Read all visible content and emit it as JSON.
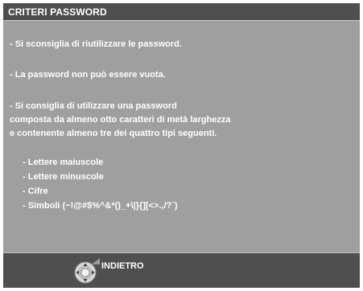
{
  "dialog": {
    "title": "CRITERI PASSWORD",
    "lines": [
      "- Si sconsiglia di riutilizzare le password.",
      "- La password non può essere vuota.",
      "- Si consiglia di utilizzare una password",
      "composta da almeno otto caratteri di metà larghezza",
      "e contenente almeno tre dei quattro tipi seguenti.",
      "- Lettere maiuscole",
      "- Lettere minuscole",
      "- Cifre",
      "- Simboli (~!@#$%^&*()_+\\|}{][<>.,/?`)"
    ],
    "back_label": "INDIETRO",
    "back_icon": "remote-dpad-icon"
  },
  "colors": {
    "panel_bg": "#a09fa0",
    "bar_bg": "#4f4f4f",
    "text": "#ffffff"
  }
}
